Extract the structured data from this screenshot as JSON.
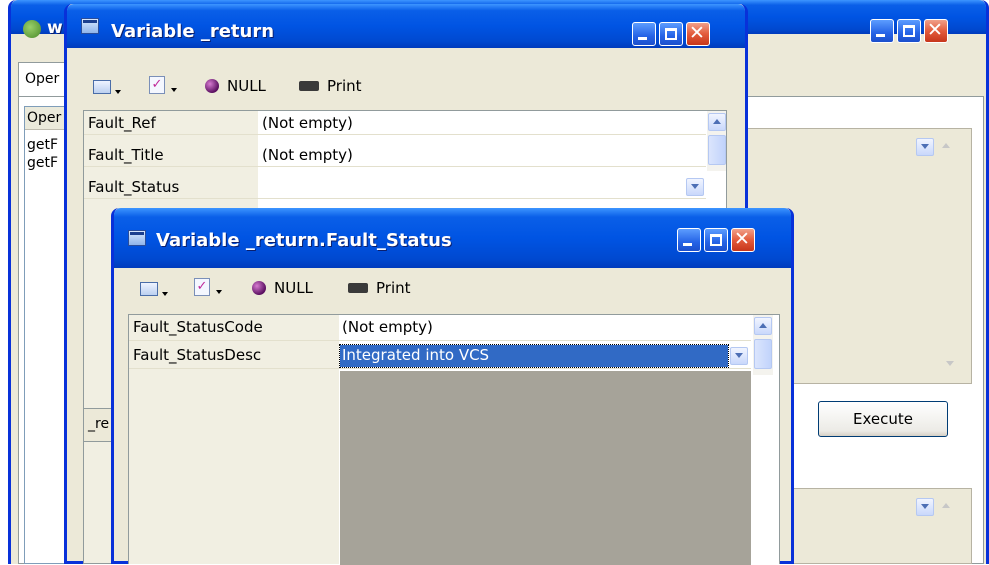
{
  "background_window": {
    "title": "w",
    "tab_label": "Oper",
    "list_header": "Oper",
    "list_items": [
      "getF",
      "getF"
    ],
    "execute_label": "Execute"
  },
  "window_return": {
    "title": "Variable _return",
    "toolbar": {
      "null_label": "NULL",
      "print_label": "Print"
    },
    "rows": [
      {
        "name": "Fault_Ref",
        "value": "(Not empty)"
      },
      {
        "name": "Fault_Title",
        "value": "(Not empty)"
      },
      {
        "name": "Fault_Status",
        "value": ""
      }
    ],
    "bottom_tab": "_re"
  },
  "window_status": {
    "title": "Variable _return.Fault_Status",
    "toolbar": {
      "null_label": "NULL",
      "print_label": "Print"
    },
    "rows": [
      {
        "name": "Fault_StatusCode",
        "value": "(Not empty)"
      },
      {
        "name": "Fault_StatusDesc",
        "value": "Integrated into VCS"
      }
    ]
  },
  "colors": {
    "titlebar": "#0054e3",
    "selection": "#316ac5",
    "empty_grid": "#a6a399",
    "close_button": "#e35b3b"
  }
}
